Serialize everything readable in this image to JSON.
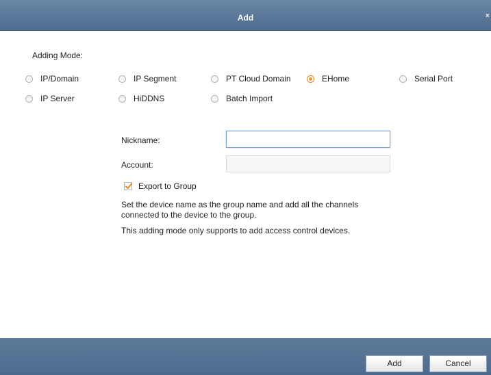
{
  "dialog": {
    "title": "Add",
    "close_glyph": "×"
  },
  "adding_mode": {
    "label": "Adding Mode:",
    "options": [
      {
        "label": "IP/Domain",
        "checked": false
      },
      {
        "label": "IP Segment",
        "checked": false
      },
      {
        "label": "PT Cloud Domain",
        "checked": false
      },
      {
        "label": "EHome",
        "checked": true
      },
      {
        "label": "Serial Port",
        "checked": false
      },
      {
        "label": "IP Server",
        "checked": false
      },
      {
        "label": "HiDDNS",
        "checked": false
      },
      {
        "label": "Batch Import",
        "checked": false
      }
    ]
  },
  "form": {
    "nickname_label": "Nickname:",
    "nickname_value": "",
    "account_label": "Account:",
    "account_value": "",
    "export_label": "Export to Group",
    "export_checked": true,
    "desc_line1": "Set the device name as the group name and add all the channels",
    "desc_line2": "connected to the device to the group.",
    "note": "This adding mode only supports to add access control devices."
  },
  "buttons": {
    "add": "Add",
    "cancel": "Cancel"
  },
  "colors": {
    "titlebar": "#5a769a",
    "radio_selected": "#f29c2b",
    "checkbox_check": "#e8891a",
    "input_focus_border": "#7da2ce"
  }
}
